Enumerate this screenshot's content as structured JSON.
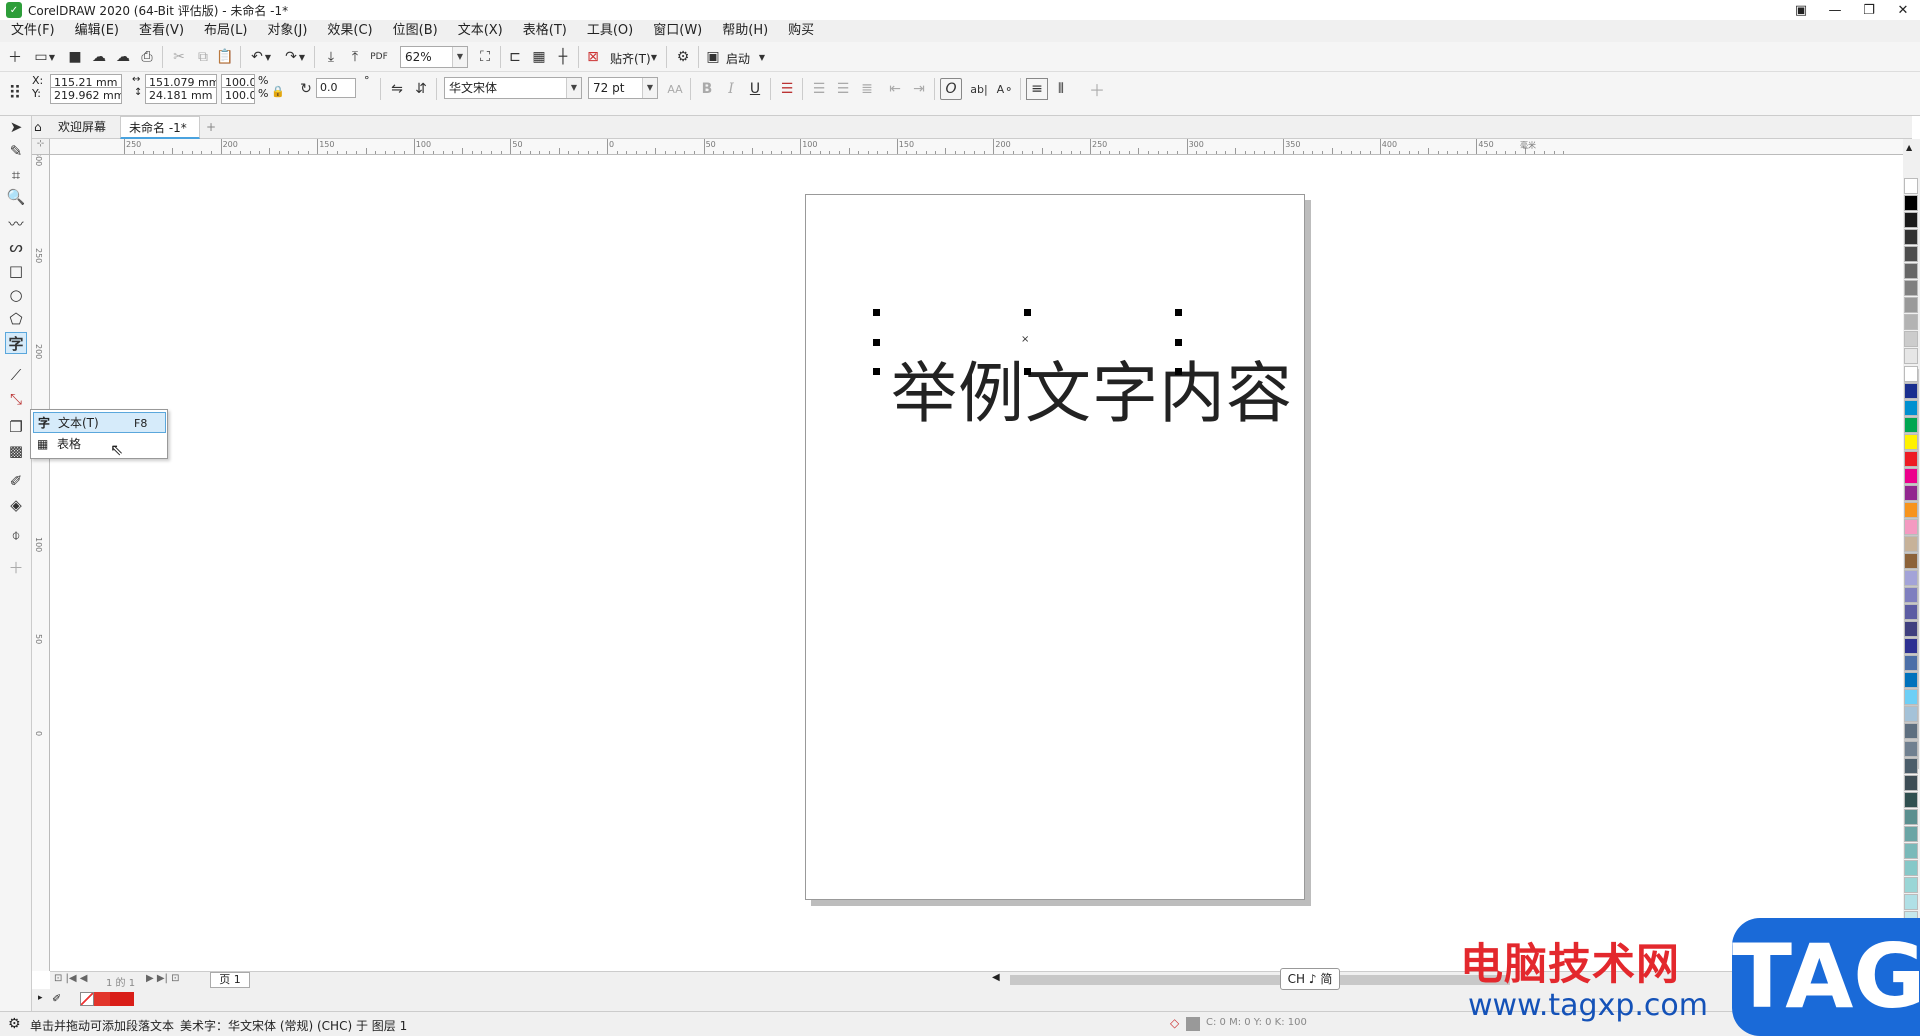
{
  "window": {
    "title": "CorelDRAW 2020 (64-Bit 评估版) - 未命名 -1*",
    "logo_glyph": "✓",
    "buttons": [
      "▣",
      "—",
      "❐",
      "✕"
    ]
  },
  "menu": [
    "文件(F)",
    "编辑(E)",
    "查看(V)",
    "布局(L)",
    "对象(J)",
    "效果(C)",
    "位图(B)",
    "文本(X)",
    "表格(T)",
    "工具(O)",
    "窗口(W)",
    "帮助(H)",
    "购买"
  ],
  "toolbar": {
    "zoom_value": "62%",
    "snap_label": "贴齐(T)",
    "launch_label": "启动"
  },
  "propbar": {
    "x_label": "X:",
    "y_label": "Y:",
    "x_value": "115.21 mm",
    "y_value": "219.962 mm",
    "w_value": "151.079 mm",
    "h_value": "24.181 mm",
    "scale_w": "100.0",
    "scale_h": "100.0",
    "percent": "%",
    "rotation": "0.0",
    "degree": "°",
    "font_name": "华文宋体",
    "font_size": "72 pt",
    "bold": "B",
    "italic": "I",
    "underline": "U"
  },
  "tabs": {
    "welcome": "欢迎屏幕",
    "document": "未命名 -1*",
    "add": "+"
  },
  "ruler": {
    "h_ticks": [
      "250",
      "200",
      "150",
      "100",
      "50",
      "0",
      "50",
      "100",
      "150",
      "200",
      "250",
      "300",
      "350",
      "400",
      "450"
    ],
    "h_unit": "毫米",
    "v_ticks": [
      "300",
      "250",
      "200",
      "150",
      "100",
      "50",
      "0"
    ]
  },
  "canvas": {
    "sample_text": "举例文字内容",
    "center_mark": "×"
  },
  "flyout": {
    "tool_glyph": "字",
    "text_item": "文本(T)",
    "text_shortcut": "F8",
    "table_item": "表格"
  },
  "pagebar": {
    "page_counter": "1 的 1",
    "page_tab": "页 1"
  },
  "statusbar": {
    "hint": "单击并拖动可添加段落文本",
    "info": "美术字：华文宋体 (常规) (CHC) 于 图层 1",
    "color_info": "C: 0 M: 0 Y: 0 K: 100"
  },
  "ime": {
    "text": "CH ♪ 简"
  },
  "watermark": {
    "site_name": "电脑技术网",
    "url": "www.tagxp.com",
    "tag": "TAG"
  },
  "colors": {
    "accent": "#4aa3df",
    "brand_green": "#2e9e3a",
    "palette": [
      "#ffffff",
      "#000000",
      "#1a1a1a",
      "#333333",
      "#4d4d4d",
      "#666666",
      "#808080",
      "#999999",
      "#b3b3b3",
      "#cccccc",
      "#e6e6e6",
      "#ffffff",
      "#1a2f8f",
      "#0090d0",
      "#00a651",
      "#fff200",
      "#ed1c24",
      "#ec008c",
      "#92278f",
      "#f7941d",
      "#f49ac1",
      "#c7b299",
      "#8c6239",
      "#a3a3d8",
      "#7f7fbf",
      "#5c5ca3",
      "#3f3f7f",
      "#2e3192",
      "#4c6fa8",
      "#0072bc",
      "#6dcff6",
      "#a4c2d8",
      "#5e6f80",
      "#708090",
      "#4b5d6a",
      "#3d4d55",
      "#2f4f4f",
      "#5b8f8f",
      "#6aa5a5",
      "#79b9b9",
      "#86c8c8",
      "#9ad6d6",
      "#b0e0e6",
      "#c5e8ec"
    ]
  }
}
